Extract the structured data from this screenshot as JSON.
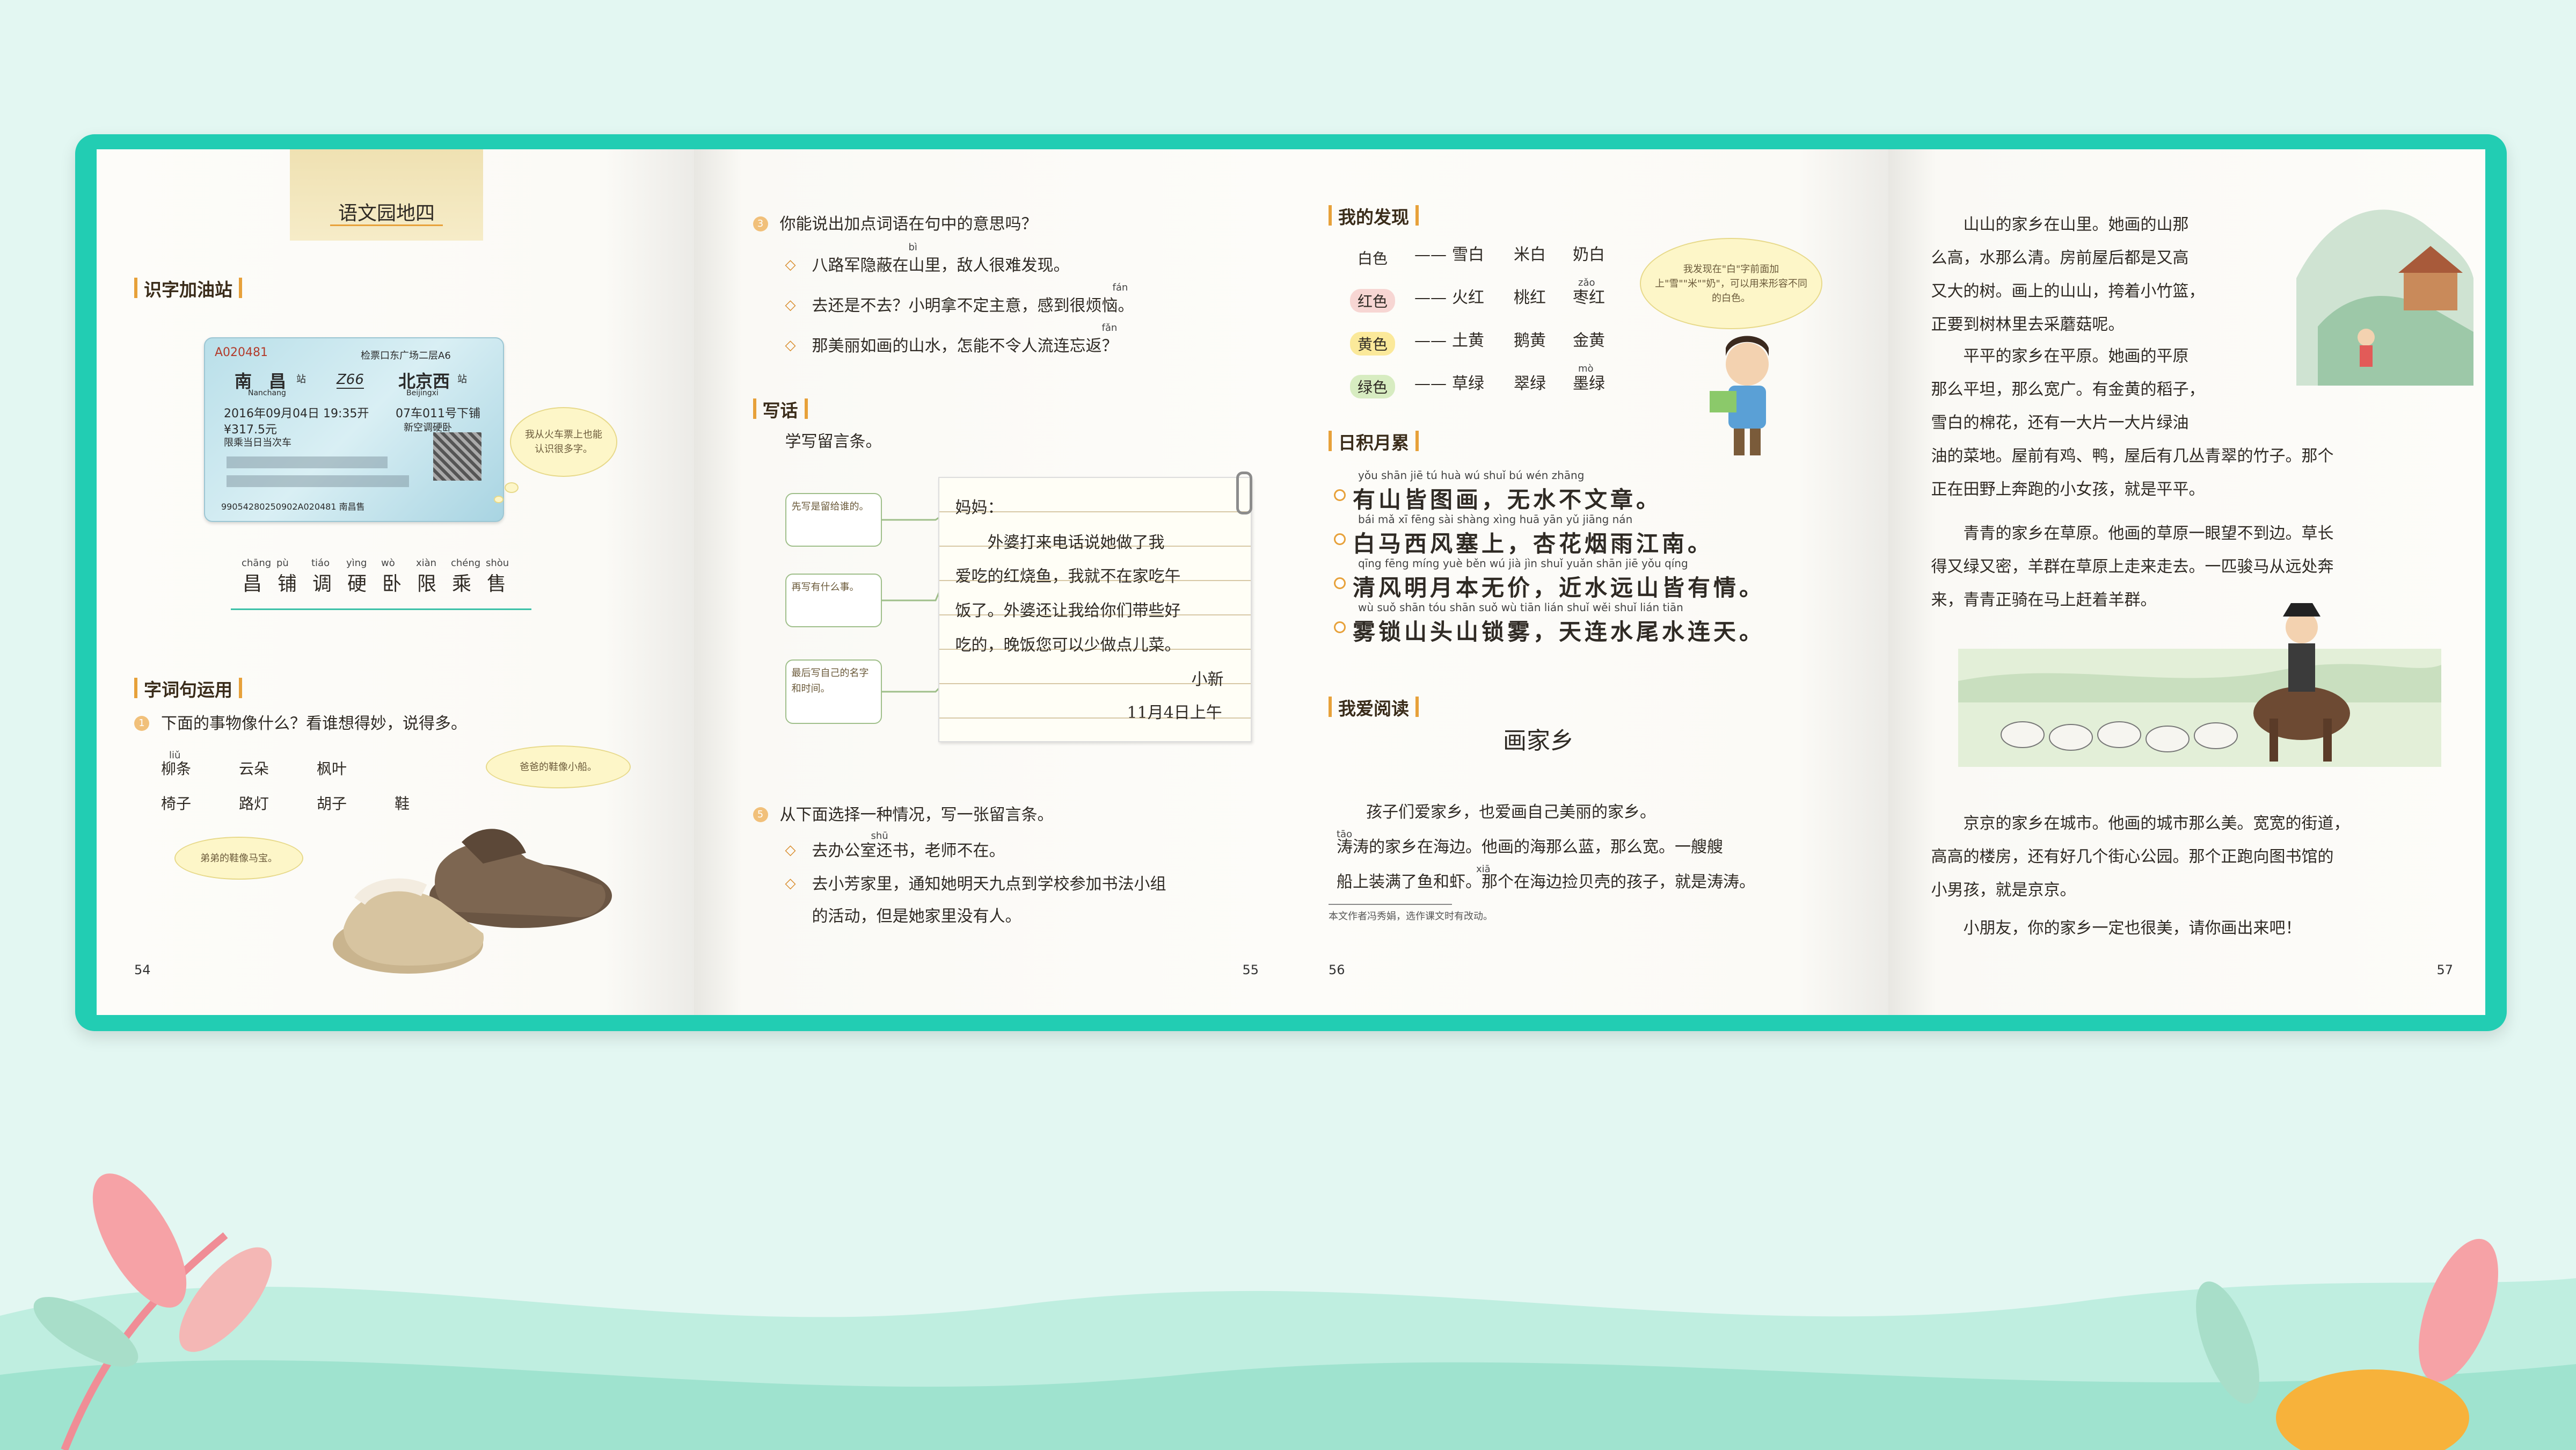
{
  "page54": {
    "banner": "语文园地四",
    "section1": "识字加油站",
    "ticket": {
      "serial": "A020481",
      "gate": "检票口东广场二层A6",
      "from": "南　昌",
      "from_py": "Nanchang",
      "station_suffix": "站",
      "train": "Z66",
      "to": "北京西",
      "to_py": "Beijingxi",
      "datetime": "2016年09月04日 19:35开",
      "car": "07车011号下铺",
      "price": "¥317.5元",
      "note1": "限乘当日当次车",
      "note2": "新空调硬卧",
      "code": "99054280250902A020481 南昌售"
    },
    "ticket_bubble": "我从火车票上也能认识很多字。",
    "chars": [
      {
        "py": "chāng",
        "ch": "昌"
      },
      {
        "py": "pù",
        "ch": "铺"
      },
      {
        "py": "tiáo",
        "ch": "调"
      },
      {
        "py": "yìng",
        "ch": "硬"
      },
      {
        "py": "wò",
        "ch": "卧"
      },
      {
        "py": "xiàn",
        "ch": "限"
      },
      {
        "py": "chéng",
        "ch": "乘"
      },
      {
        "py": "shòu",
        "ch": "售"
      }
    ],
    "section2": "字词句运用",
    "q1": "下面的事物像什么？看谁想得妙，说得多。",
    "words": {
      "liu_py": "liǔ",
      "w1": "柳条",
      "w2": "云朵",
      "w3": "枫叶",
      "w4": "椅子",
      "w5": "路灯",
      "w6": "胡子",
      "w7": "鞋"
    },
    "bubble_dad": "爸爸的鞋像小船。",
    "bubble_sis": "弟弟的鞋像马宝。",
    "page_num": "54"
  },
  "page55": {
    "q3": "你能说出加点词语在句中的意思吗？",
    "q3_items": [
      {
        "text": "八路军隐蔽在山里，敌人很难发现。",
        "py": "bì"
      },
      {
        "text": "去还是不去？小明拿不定主意，感到很烦恼。",
        "py": "fán"
      },
      {
        "text": "那美丽如画的山水，怎能不令人流连忘返？",
        "py": "fǎn"
      }
    ],
    "section": "写话",
    "sub": "学写留言条。",
    "mm_box1": "先写是留给谁的。",
    "mm_box2": "再写有什么事。",
    "mm_box3": "最后写自己的名字和时间。",
    "note_lines": [
      "妈妈：",
      "外婆打来电话说她做了我",
      "爱吃的红烧鱼，我就不在家吃午",
      "饭了。外婆还让我给你们带些好",
      "吃的，晚饭您可以少做点儿菜。",
      "小新",
      "11月4日上午"
    ],
    "q5": "从下面选择一种情况，写一张留言条。",
    "q5_items": [
      "去办公室还书，老师不在。",
      "去小芳家里，通知她明天九点到学校参加书法小组",
      "的活动，但是她家里没有人。"
    ],
    "q5_py": "shū",
    "page_num": "55"
  },
  "page56": {
    "section1": "我的发现",
    "rows": [
      {
        "k": "白色",
        "a": "雪白",
        "b": "米白",
        "c": "奶白"
      },
      {
        "k": "红色",
        "a": "火红",
        "b": "桃红",
        "c": "枣红",
        "py": "zǎo"
      },
      {
        "k": "黄色",
        "a": "土黄",
        "b": "鹅黄",
        "c": "金黄"
      },
      {
        "k": "绿色",
        "a": "草绿",
        "b": "翠绿",
        "c": "墨绿",
        "py": "mò"
      }
    ],
    "bubble": "我发现在\"白\"字前面加上\"雪\"\"米\"\"奶\"，可以用来形容不同的白色。",
    "section2": "日积月累",
    "poem": [
      {
        "py": "yǒu shān jiē tú huà   wú shuǐ bú wén zhāng",
        "line": "有山皆图画，无水不文章。"
      },
      {
        "py": "bái mǎ xī fēng sài shàng   xìng huā yān yǔ jiāng nán",
        "line": "白马西风塞上，杏花烟雨江南。"
      },
      {
        "py": "qīng fēng míng yuè běn wú jià   jìn shuǐ yuǎn shān jiē yǒu qíng",
        "line": "清风明月本无价，近水远山皆有情。"
      },
      {
        "py": "wù suǒ shān tóu shān suǒ wù   tiān lián shuǐ wěi shuǐ lián tiān",
        "line": "雾锁山头山锁雾，天连水尾水连天。"
      }
    ],
    "section3": "我爱阅读",
    "title": "画家乡",
    "reading": [
      "孩子们爱家乡，也爱画自己美丽的家乡。",
      "涛涛的家乡在海边。他画的海那么蓝，那么宽。一艘艘",
      "船上装满了鱼和虾。那个在海边捡贝壳的孩子，就是涛涛。"
    ],
    "py_tao": "tāo",
    "py_xia": "xiā",
    "footnote": "本文作者冯秀娟，选作课文时有改动。",
    "page_num": "56"
  },
  "page57": {
    "paras": [
      [
        "山山的家乡在山里。她画的山那",
        "么高，水那么清。房前屋后都是又高",
        "又大的树。画上的山山，挎着小竹篮，",
        "正要到树林里去采蘑菇呢。"
      ],
      [
        "平平的家乡在平原。她画的平原",
        "那么平坦，那么宽广。有金黄的稻子，",
        "雪白的棉花，还有一大片一大片绿油",
        "油的菜地。屋前有鸡、鸭，屋后有几丛青翠的竹子。那个",
        "正在田野上奔跑的小女孩，就是平平。"
      ],
      [
        "青青的家乡在草原。他画的草原一眼望不到边。草长",
        "得又绿又密，羊群在草原上走来走去。一匹骏马从远处奔",
        "来，青青正骑在马上赶着羊群。"
      ],
      [
        "京京的家乡在城市。他画的城市那么美。宽宽的街道，",
        "高高的楼房，还有好几个街心公园。那个正跑向图书馆的",
        "小男孩，就是京京。"
      ],
      [
        "小朋友，你的家乡一定也很美，请你画出来吧！"
      ]
    ],
    "page_num": "57"
  },
  "colors": {
    "frame": "#22cdb3",
    "accent": "#e7a13a",
    "bg": "#e3f7f2"
  }
}
